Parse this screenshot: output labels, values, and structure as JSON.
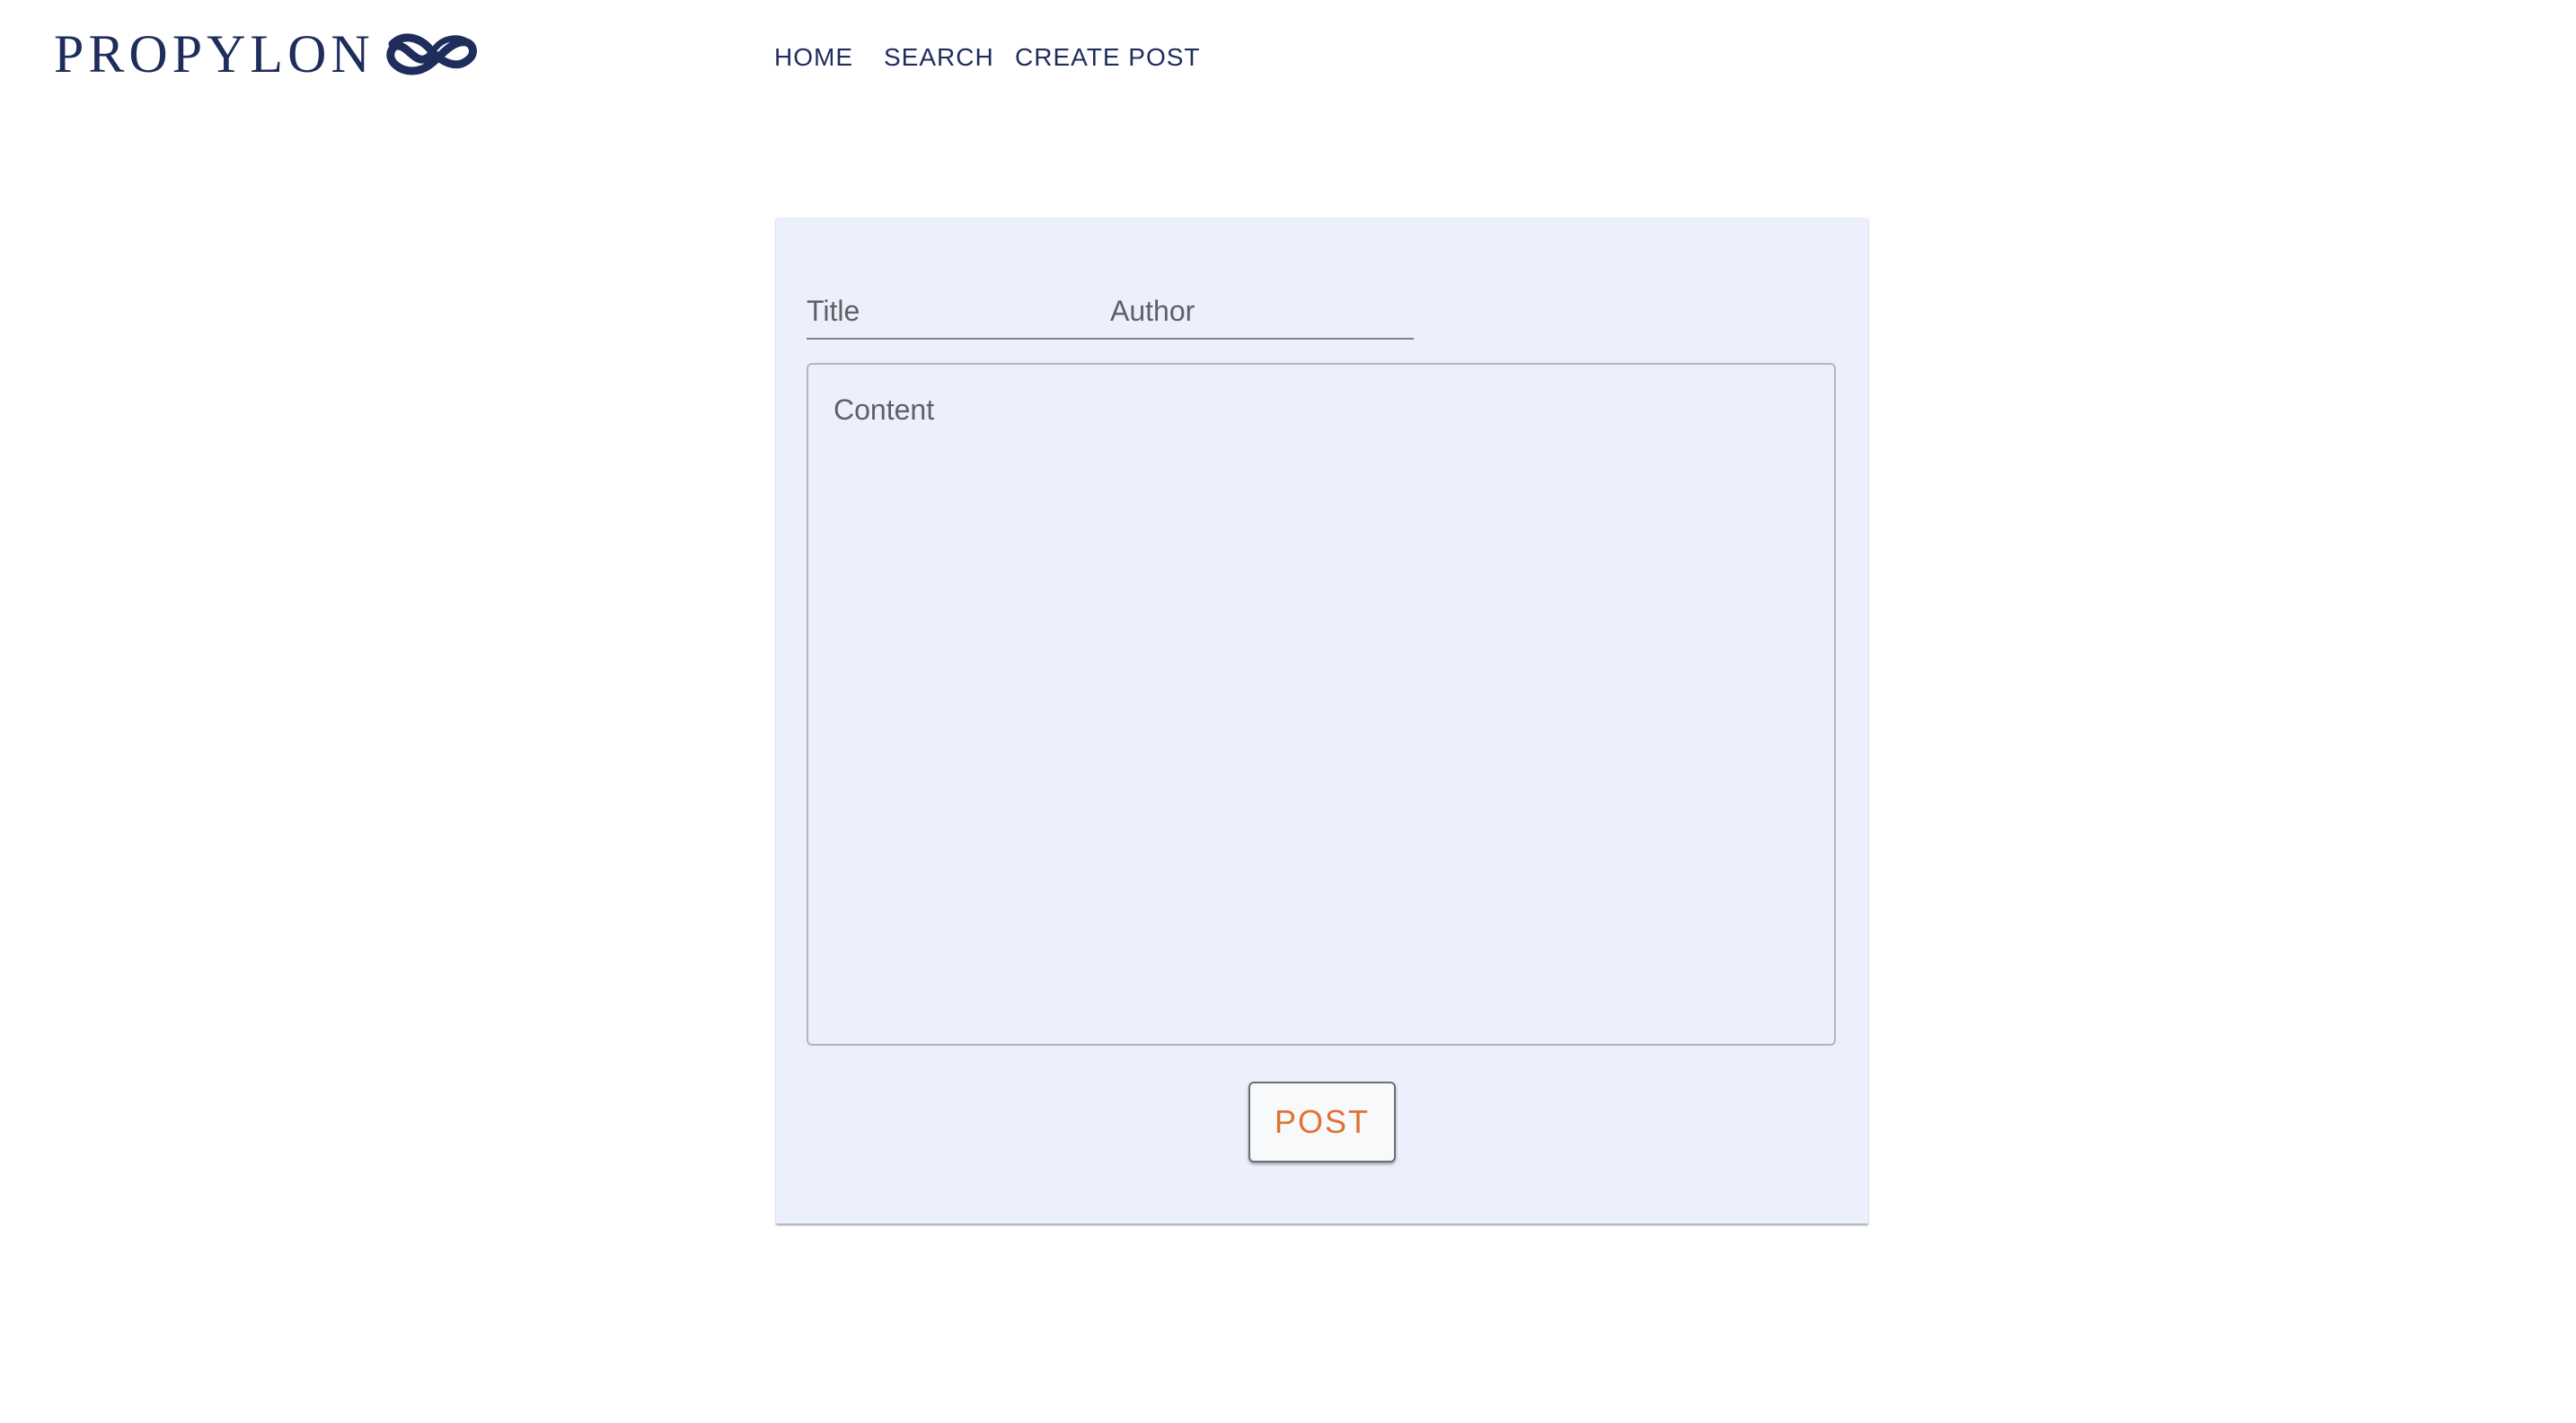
{
  "brand": {
    "name": "PROPYLON",
    "color": "#1f2d5c"
  },
  "nav": {
    "items": [
      {
        "label": "HOME"
      },
      {
        "label": "SEARCH"
      },
      {
        "label": "CREATE POST"
      }
    ]
  },
  "form": {
    "title_placeholder": "Title",
    "title_value": "",
    "author_placeholder": "Author",
    "author_value": "",
    "content_placeholder": "Content",
    "content_value": "",
    "submit_label": "POST",
    "card_background": "#ebf0fc",
    "accent_color": "#e07234"
  }
}
